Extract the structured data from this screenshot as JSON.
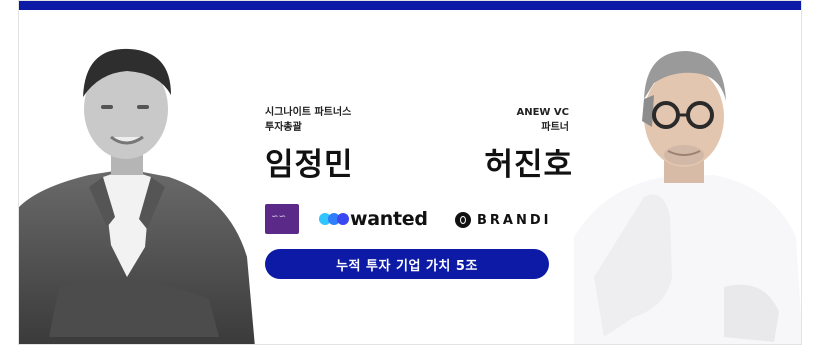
{
  "left_person": {
    "role_line1": "시그나이트 파트너스",
    "role_line2": "투자총괄",
    "name": "임정민"
  },
  "right_person": {
    "role_line1": "ANEW VC",
    "role_line2": "파트너",
    "name": "허진호"
  },
  "logos": {
    "wanted": "wanted",
    "brandi": "BRANDI"
  },
  "cta": {
    "label": "누적 투자 기업 가치 5조"
  },
  "colors": {
    "accent": "#0c1aa6",
    "kakao_purple": "#5b2a88",
    "wanted_blue_dark": "#3a48f0",
    "wanted_blue_mid": "#2f7dfa",
    "wanted_blue_light": "#31c5ff"
  },
  "icons": [
    "kakaostyle-logo-icon",
    "wanted-logo-icon",
    "brandi-logo-icon"
  ]
}
